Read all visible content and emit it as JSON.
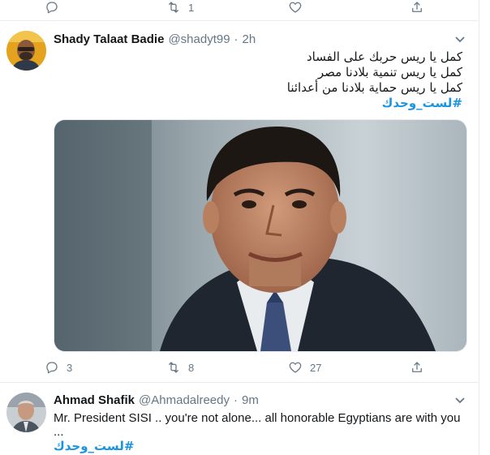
{
  "top_actions": {
    "reply_count": "",
    "retweet_count": "1",
    "like_count": ""
  },
  "tweets": [
    {
      "name": "Shady Talaat Badie",
      "handle": "@shadyt99",
      "sep": "·",
      "time": "2h",
      "lines": [
        "كمل يا ريس حربك على الفساد",
        "كمل يا ريس تنمية بلادنا مصر",
        "كمل يا ريس حماية بلادنا من أعدائنا"
      ],
      "hashtag": "#لست_وحدك",
      "reply_count": "3",
      "retweet_count": "8",
      "like_count": "27"
    },
    {
      "name": "Ahmad Shafik",
      "handle": "@Ahmadalreedy",
      "sep": "·",
      "time": "9m",
      "text": "Mr. President SISI .. you're  not alone... all honorable Egyptians are with you",
      "text_cont": "...",
      "hashtag": "#لست_وحدك"
    }
  ],
  "colors": {
    "accent": "#1b95e0",
    "muted": "#657786",
    "border": "#e6ecf0"
  },
  "icons": [
    "reply-icon",
    "retweet-icon",
    "like-icon",
    "share-icon",
    "chevron-down-icon"
  ]
}
